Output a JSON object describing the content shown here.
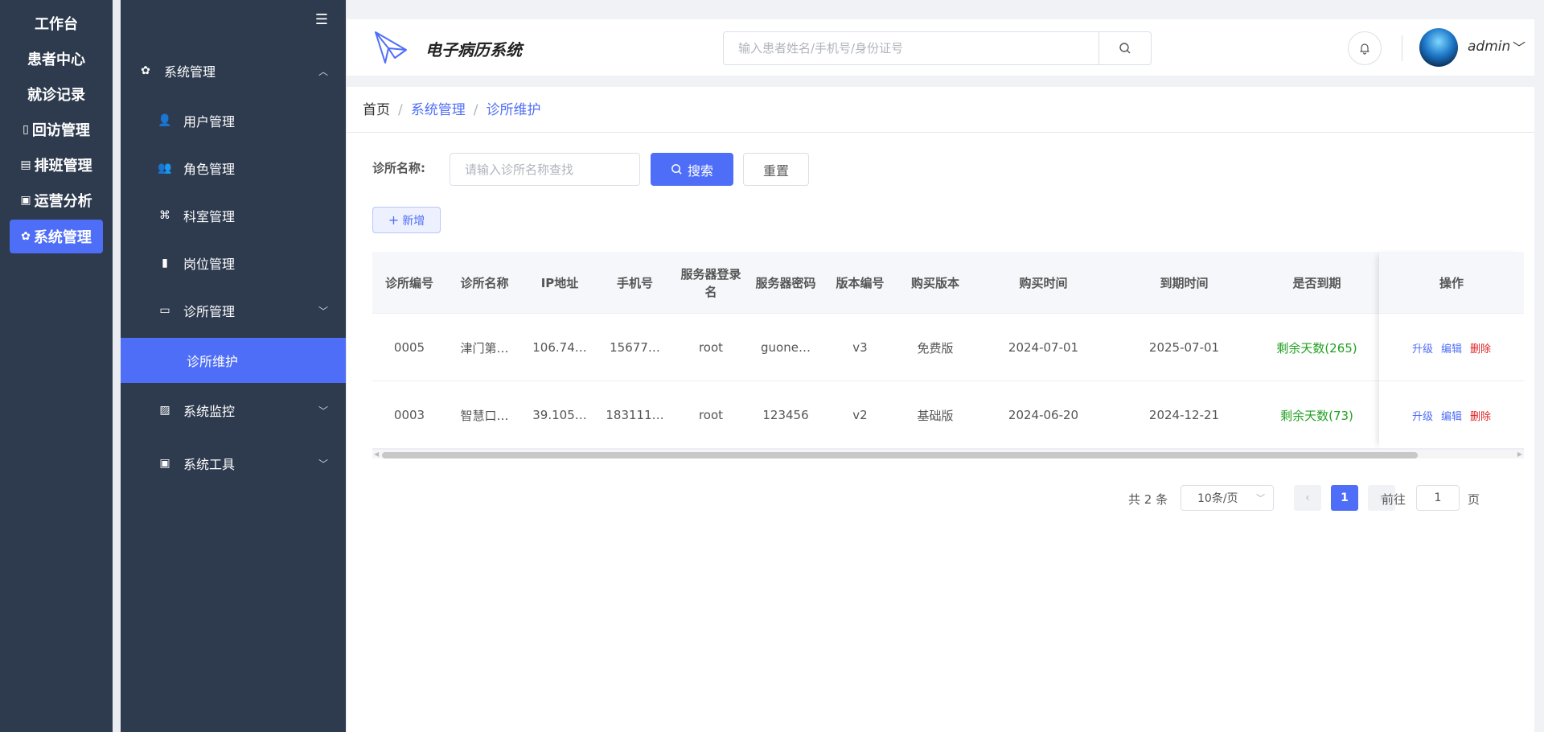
{
  "primary_nav": {
    "items": [
      {
        "label": "工作台",
        "icon": ""
      },
      {
        "label": "患者中心",
        "icon": ""
      },
      {
        "label": "就诊记录",
        "icon": ""
      },
      {
        "label": "回访管理",
        "icon": "▯"
      },
      {
        "label": "排班管理",
        "icon": "▤"
      },
      {
        "label": "运营分析",
        "icon": "▣"
      },
      {
        "label": "系统管理",
        "icon": "✿"
      }
    ],
    "active": "系统管理"
  },
  "secondary_nav": {
    "collapse_icon": "☰",
    "items": [
      {
        "label": "系统管理",
        "icon": "✿",
        "arrow": "︿"
      },
      {
        "label": "用户管理",
        "icon": "👤",
        "arrow": ""
      },
      {
        "label": "角色管理",
        "icon": "👥",
        "arrow": ""
      },
      {
        "label": "科室管理",
        "icon": "⌘",
        "arrow": ""
      },
      {
        "label": "岗位管理",
        "icon": "▮",
        "arrow": ""
      },
      {
        "label": "诊所管理",
        "icon": "▭",
        "arrow": "﹀"
      },
      {
        "label": "诊所维护",
        "icon": "",
        "arrow": ""
      },
      {
        "label": "系统监控",
        "icon": "▨",
        "arrow": "﹀"
      },
      {
        "label": "系统工具",
        "icon": "▣",
        "arrow": "﹀"
      }
    ],
    "active": "诊所维护"
  },
  "header": {
    "app_title": "电子病历系统",
    "search_placeholder": "输入患者姓名/手机号/身份证号",
    "username": "admin"
  },
  "breadcrumb": {
    "home": "首页",
    "sep": "/",
    "crumbs": [
      "系统管理",
      "诊所维护"
    ]
  },
  "filter": {
    "label": "诊所名称:",
    "placeholder": "请输入诊所名称查找",
    "search_label": "搜索",
    "reset_label": "重置",
    "add_label": "新增"
  },
  "table": {
    "columns": [
      "诊所编号",
      "诊所名称",
      "IP地址",
      "手机号",
      "服务器登录名",
      "服务器密码",
      "版本编号",
      "购买版本",
      "购买时间",
      "到期时间",
      "是否到期",
      "操作"
    ],
    "rows": [
      {
        "id": "0005",
        "name": "津门第…",
        "ip": "106.74…",
        "phone": "15677…",
        "login": "root",
        "password": "guone…",
        "version": "v3",
        "plan": "免费版",
        "buy_date": "2024-07-01",
        "expire_date": "2025-07-01",
        "status": "剩余天数(265)"
      },
      {
        "id": "0003",
        "name": "智慧口…",
        "ip": "39.105…",
        "phone": "183111…",
        "login": "root",
        "password": "123456",
        "version": "v2",
        "plan": "基础版",
        "buy_date": "2024-06-20",
        "expire_date": "2024-12-21",
        "status": "剩余天数(73)"
      }
    ],
    "actions": {
      "upgrade": "升级",
      "edit": "编辑",
      "delete": "删除"
    }
  },
  "pagination": {
    "total": "共 2 条",
    "page_size": "10条/页",
    "current_page": "1",
    "goto_prefix": "前往",
    "goto_value": "1",
    "goto_suffix": "页"
  },
  "colors": {
    "primary": "#4f6ef7",
    "sidebar": "#2e3b4e",
    "success": "#21a021",
    "danger": "#e02020"
  }
}
